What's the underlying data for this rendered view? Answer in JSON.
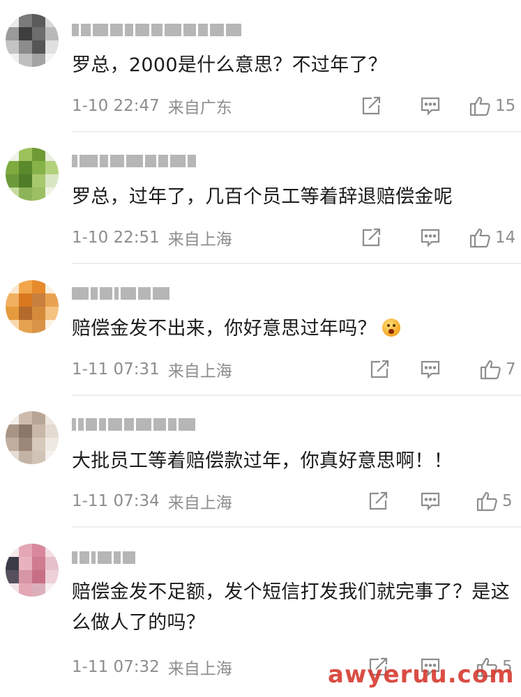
{
  "comments": [
    {
      "text": "罗总，2000是什么意思？不过年了？",
      "time": "1-10 22:47",
      "location": "来自广东",
      "likes": "15",
      "avatar_colors": [
        "#e9e9e9",
        "#7a7a7a",
        "#5a5a5a",
        "#d8d8d8",
        "#9a9a9a",
        "#3e3e3e",
        "#6d6d6d",
        "#b9b9b9",
        "#c4c4c4",
        "#8c8c8c",
        "#555555",
        "#e0e0e0",
        "#f0f0f0",
        "#bfbfbf",
        "#a3a3a3",
        "#f4f4f4"
      ]
    },
    {
      "text": "罗总，过年了，几百个员工等着辞退赔偿金呢",
      "time": "1-10 22:51",
      "location": "来自上海",
      "likes": "14",
      "avatar_colors": [
        "#eef3e8",
        "#9bc15a",
        "#6f9a35",
        "#e8efde",
        "#7eaa3f",
        "#5b8a2c",
        "#86b24a",
        "#b3d17a",
        "#6c9a3a",
        "#4f7d27",
        "#a8c86d",
        "#d9e6c3",
        "#c5dba0",
        "#8db457",
        "#9cbf63",
        "#eef4e4"
      ]
    },
    {
      "text": "赔偿金发不出来，你好意思过年吗？",
      "time": "1-11 07:31",
      "location": "来自上海",
      "likes": "7",
      "avatar_colors": [
        "#fbe8cf",
        "#f2a64b",
        "#e68a2b",
        "#fbefdf",
        "#f0b060",
        "#d9781f",
        "#c8803f",
        "#e9a250",
        "#e59a3d",
        "#b36a2a",
        "#d48b3a",
        "#f5c27f",
        "#f7d9ad",
        "#e5a24f",
        "#d99346",
        "#fdf1e2"
      ]
    },
    {
      "text": "大批员工等着赔偿款过年，你真好意思啊！！",
      "time": "1-11 07:34",
      "location": "来自上海",
      "likes": "5",
      "avatar_colors": [
        "#f2eeea",
        "#cdbcae",
        "#b7a595",
        "#ede6df",
        "#a89585",
        "#8c7868",
        "#c9b8a8",
        "#e4dbd2",
        "#bfae9e",
        "#9b8878",
        "#d7c9bb",
        "#efe9e3",
        "#e6ddd4",
        "#c2b3a5",
        "#d1c3b5",
        "#f5f1ed"
      ]
    },
    {
      "text": "赔偿金发不足额，发个短信打发我们就完事了？是这么做人了的吗？",
      "time": "1-11 07:32",
      "location": "来自上海",
      "likes": "5",
      "avatar_colors": [
        "#f5e9ec",
        "#e5a7b5",
        "#d9879c",
        "#f2dde2",
        "#3b3b48",
        "#e9b2bf",
        "#cf7b90",
        "#e6c0ca",
        "#55505c",
        "#d795a6",
        "#c86f86",
        "#eed0d8",
        "#f3e3e7",
        "#e2a8b6",
        "#dcb0bb",
        "#f8eef1"
      ]
    }
  ],
  "watermark": "awyeruu.com"
}
